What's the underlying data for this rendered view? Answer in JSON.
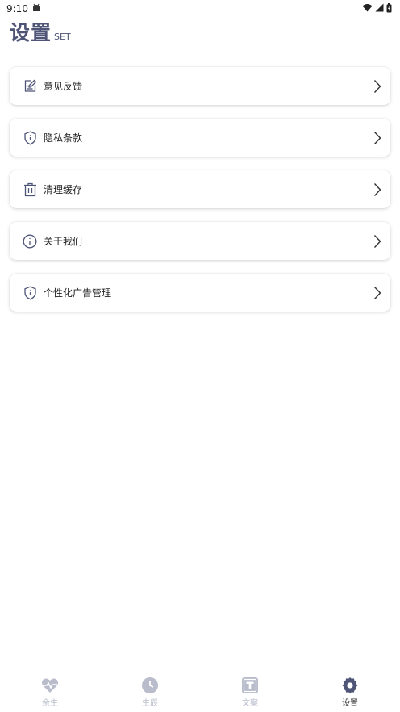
{
  "status_bar": {
    "time": "9:10",
    "left_icons": [
      "android-notification-icon"
    ],
    "right_icons": [
      "wifi-icon",
      "signal-icon",
      "battery-icon"
    ]
  },
  "header": {
    "title": "设置",
    "subtitle": "SET"
  },
  "menu": {
    "items": [
      {
        "label": "意见反馈",
        "icon": "feedback-edit-icon"
      },
      {
        "label": "隐私条款",
        "icon": "shield-info-icon"
      },
      {
        "label": "清理缓存",
        "icon": "trash-icon"
      },
      {
        "label": "关于我们",
        "icon": "info-circle-icon"
      },
      {
        "label": "个性化广告管理",
        "icon": "shield-info-icon"
      }
    ]
  },
  "tabbar": {
    "tabs": [
      {
        "label": "余生",
        "icon": "heart-pulse-icon",
        "active": false
      },
      {
        "label": "生辰",
        "icon": "clock-icon",
        "active": false
      },
      {
        "label": "文案",
        "icon": "text-t-icon",
        "active": false
      },
      {
        "label": "设置",
        "icon": "gear-icon",
        "active": true
      }
    ]
  },
  "colors": {
    "title": "#4f5576",
    "icon_stroke": "#4f5576",
    "tab_inactive": "#b8bccb",
    "tab_active": "#4f5576"
  }
}
